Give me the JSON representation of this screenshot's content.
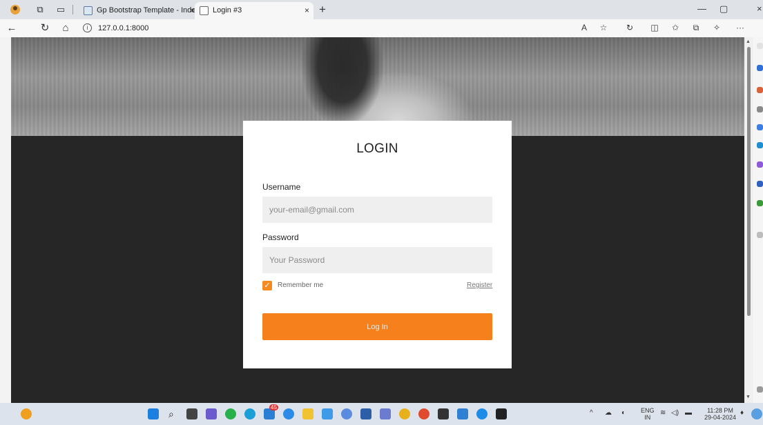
{
  "tabs": [
    {
      "label": "Gp Bootstrap Template - Index",
      "close": "×"
    },
    {
      "label": "Login #3",
      "close": "×"
    }
  ],
  "new_tab": "+",
  "window_controls": {
    "minimize": "—",
    "maximize": "▢",
    "close": "×"
  },
  "address_bar": {
    "url": "127.0.0.1:8000",
    "info_glyph": "i"
  },
  "toolbar_glyphs": {
    "back": "←",
    "refresh": "↻",
    "home": "⌂",
    "read_aloud": "A",
    "favorite": "☆",
    "refresh2": "↻",
    "split": "◫",
    "favorites": "✩",
    "collections": "⧉",
    "extensions": "✧",
    "more": "···"
  },
  "login": {
    "title": "LOGIN",
    "username_label": "Username",
    "username_placeholder": "your-email@gmail.com",
    "password_label": "Password",
    "password_placeholder": "Your Password",
    "remember_label": "Remember me",
    "remember_checked": true,
    "register_link": "Register",
    "submit_label": "Log In"
  },
  "colors": {
    "accent": "#f5801c",
    "page_background": "#262626",
    "card_background": "#ffffff"
  },
  "taskbar": {
    "language": "ENG",
    "region": "IN",
    "time": "11:28 PM",
    "date": "29-04-2024",
    "notification_count": "45"
  }
}
